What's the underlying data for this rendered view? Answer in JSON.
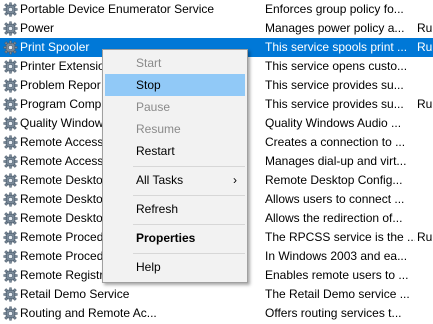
{
  "services": [
    {
      "name": "Portable Device Enumerator Service",
      "desc": "Enforces group policy fo...",
      "status": ""
    },
    {
      "name": "Power",
      "desc": "Manages power policy a...",
      "status": "Ru"
    },
    {
      "name": "Print Spooler",
      "desc": "This service spools print ...",
      "status": "Ru"
    },
    {
      "name": "Printer Extensio",
      "desc": "This service opens custo...",
      "status": ""
    },
    {
      "name": "Problem Repor",
      "desc": "This service provides su...",
      "status": ""
    },
    {
      "name": "Program Comp",
      "desc": "This service provides su...",
      "status": "Ru"
    },
    {
      "name": "Quality Window",
      "desc": "Quality Windows Audio ...",
      "status": ""
    },
    {
      "name": "Remote Access",
      "desc": "Creates a connection to ...",
      "status": ""
    },
    {
      "name": "Remote Access",
      "desc": "Manages dial-up and virt...",
      "status": ""
    },
    {
      "name": "Remote Deskto",
      "desc": "Remote Desktop Config...",
      "status": ""
    },
    {
      "name": "Remote Deskto",
      "desc": "Allows users to connect ...",
      "status": ""
    },
    {
      "name": "Remote Deskto",
      "desc": "Allows the redirection of...",
      "status": ""
    },
    {
      "name": "Remote Proced",
      "desc": "The RPCSS service is the ...",
      "status": "Ru"
    },
    {
      "name": "Remote Proced",
      "desc": "In Windows 2003 and ea...",
      "status": ""
    },
    {
      "name": "Remote Registr",
      "desc": "Enables remote users to ...",
      "status": ""
    },
    {
      "name": "Retail Demo Service",
      "desc": "The Retail Demo service ...",
      "status": ""
    },
    {
      "name": "Routing and Remote Ac...",
      "desc": "Offers routing services t...",
      "status": ""
    }
  ],
  "selected_index": 2,
  "context_menu": {
    "start": "Start",
    "stop": "Stop",
    "pause": "Pause",
    "resume": "Resume",
    "restart": "Restart",
    "all_tasks": "All Tasks",
    "all_tasks_arrow": "›",
    "refresh": "Refresh",
    "properties": "Properties",
    "help": "Help"
  },
  "colors": {
    "selection": "#0078d7",
    "menu_hover": "#91c9f7"
  }
}
